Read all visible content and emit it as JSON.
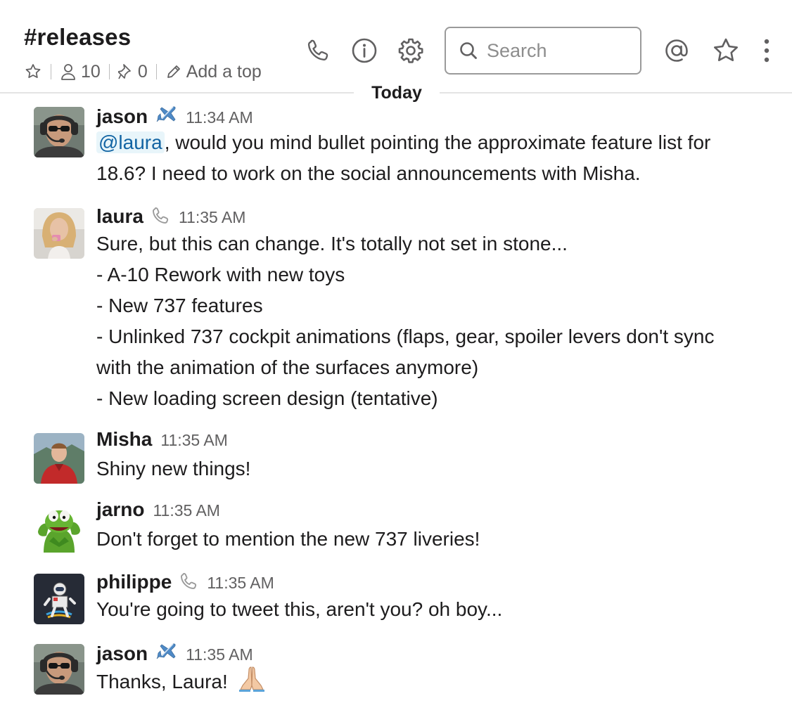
{
  "channel": {
    "name": "#releases",
    "member_count": "10",
    "pin_count": "0",
    "topic_placeholder": "Add a top"
  },
  "header_icons": [
    "phone-icon",
    "info-icon",
    "gear-icon",
    "at-icon",
    "star-icon",
    "kebab-icon"
  ],
  "search": {
    "placeholder": "Search"
  },
  "divider": {
    "label": "Today"
  },
  "colors": {
    "mention_bg": "#e8f5fa",
    "mention_text": "#1264a3",
    "secondary_text": "#616061"
  },
  "messages": [
    {
      "author": "jason",
      "status_icon": "airplane-icon",
      "time": "11:34 AM",
      "mention": "@laura",
      "text_after_mention": ", would you mind bullet pointing the approximate feature list for",
      "text_line2": "18.6? I need to work on the social announcements with Misha."
    },
    {
      "author": "laura",
      "status_icon": "phone-outline-icon",
      "time": "11:35 AM",
      "lines": [
        "Sure, but this can change. It's totally not set in stone...",
        "- A-10 Rework with new toys",
        "- New 737 features",
        "- Unlinked 737 cockpit animations (flaps, gear, spoiler levers don't sync",
        "with the animation of the surfaces anymore)",
        "- New loading screen design (tentative)"
      ]
    },
    {
      "author": "Misha",
      "time": "11:35 AM",
      "text": "Shiny new things!"
    },
    {
      "author": "jarno",
      "time": "11:35 AM",
      "text": "Don't forget to mention the new 737 liveries!"
    },
    {
      "author": "philippe",
      "status_icon": "phone-outline-icon",
      "time": "11:35 AM",
      "text": "You're going to tweet this, aren't you? oh boy..."
    },
    {
      "author": "jason",
      "status_icon": "airplane-icon",
      "time": "11:35 AM",
      "text": "Thanks, Laura!",
      "emoji": "folded-hands-emoji"
    }
  ]
}
